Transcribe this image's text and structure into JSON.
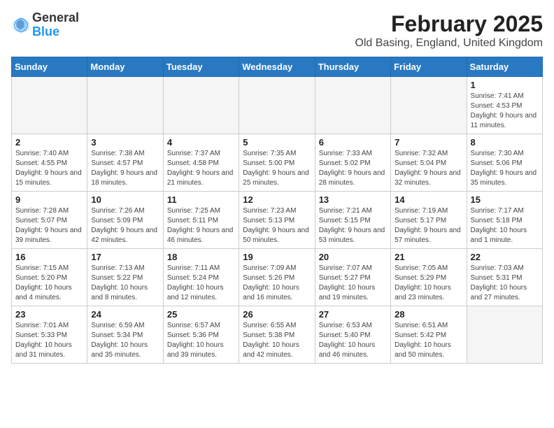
{
  "logo": {
    "general": "General",
    "blue": "Blue"
  },
  "title": "February 2025",
  "subtitle": "Old Basing, England, United Kingdom",
  "headers": [
    "Sunday",
    "Monday",
    "Tuesday",
    "Wednesday",
    "Thursday",
    "Friday",
    "Saturday"
  ],
  "weeks": [
    [
      {
        "day": "",
        "info": ""
      },
      {
        "day": "",
        "info": ""
      },
      {
        "day": "",
        "info": ""
      },
      {
        "day": "",
        "info": ""
      },
      {
        "day": "",
        "info": ""
      },
      {
        "day": "",
        "info": ""
      },
      {
        "day": "1",
        "info": "Sunrise: 7:41 AM\nSunset: 4:53 PM\nDaylight: 9 hours and 11 minutes."
      }
    ],
    [
      {
        "day": "2",
        "info": "Sunrise: 7:40 AM\nSunset: 4:55 PM\nDaylight: 9 hours and 15 minutes."
      },
      {
        "day": "3",
        "info": "Sunrise: 7:38 AM\nSunset: 4:57 PM\nDaylight: 9 hours and 18 minutes."
      },
      {
        "day": "4",
        "info": "Sunrise: 7:37 AM\nSunset: 4:58 PM\nDaylight: 9 hours and 21 minutes."
      },
      {
        "day": "5",
        "info": "Sunrise: 7:35 AM\nSunset: 5:00 PM\nDaylight: 9 hours and 25 minutes."
      },
      {
        "day": "6",
        "info": "Sunrise: 7:33 AM\nSunset: 5:02 PM\nDaylight: 9 hours and 28 minutes."
      },
      {
        "day": "7",
        "info": "Sunrise: 7:32 AM\nSunset: 5:04 PM\nDaylight: 9 hours and 32 minutes."
      },
      {
        "day": "8",
        "info": "Sunrise: 7:30 AM\nSunset: 5:06 PM\nDaylight: 9 hours and 35 minutes."
      }
    ],
    [
      {
        "day": "9",
        "info": "Sunrise: 7:28 AM\nSunset: 5:07 PM\nDaylight: 9 hours and 39 minutes."
      },
      {
        "day": "10",
        "info": "Sunrise: 7:26 AM\nSunset: 5:09 PM\nDaylight: 9 hours and 42 minutes."
      },
      {
        "day": "11",
        "info": "Sunrise: 7:25 AM\nSunset: 5:11 PM\nDaylight: 9 hours and 46 minutes."
      },
      {
        "day": "12",
        "info": "Sunrise: 7:23 AM\nSunset: 5:13 PM\nDaylight: 9 hours and 50 minutes."
      },
      {
        "day": "13",
        "info": "Sunrise: 7:21 AM\nSunset: 5:15 PM\nDaylight: 9 hours and 53 minutes."
      },
      {
        "day": "14",
        "info": "Sunrise: 7:19 AM\nSunset: 5:17 PM\nDaylight: 9 hours and 57 minutes."
      },
      {
        "day": "15",
        "info": "Sunrise: 7:17 AM\nSunset: 5:18 PM\nDaylight: 10 hours and 1 minute."
      }
    ],
    [
      {
        "day": "16",
        "info": "Sunrise: 7:15 AM\nSunset: 5:20 PM\nDaylight: 10 hours and 4 minutes."
      },
      {
        "day": "17",
        "info": "Sunrise: 7:13 AM\nSunset: 5:22 PM\nDaylight: 10 hours and 8 minutes."
      },
      {
        "day": "18",
        "info": "Sunrise: 7:11 AM\nSunset: 5:24 PM\nDaylight: 10 hours and 12 minutes."
      },
      {
        "day": "19",
        "info": "Sunrise: 7:09 AM\nSunset: 5:26 PM\nDaylight: 10 hours and 16 minutes."
      },
      {
        "day": "20",
        "info": "Sunrise: 7:07 AM\nSunset: 5:27 PM\nDaylight: 10 hours and 19 minutes."
      },
      {
        "day": "21",
        "info": "Sunrise: 7:05 AM\nSunset: 5:29 PM\nDaylight: 10 hours and 23 minutes."
      },
      {
        "day": "22",
        "info": "Sunrise: 7:03 AM\nSunset: 5:31 PM\nDaylight: 10 hours and 27 minutes."
      }
    ],
    [
      {
        "day": "23",
        "info": "Sunrise: 7:01 AM\nSunset: 5:33 PM\nDaylight: 10 hours and 31 minutes."
      },
      {
        "day": "24",
        "info": "Sunrise: 6:59 AM\nSunset: 5:34 PM\nDaylight: 10 hours and 35 minutes."
      },
      {
        "day": "25",
        "info": "Sunrise: 6:57 AM\nSunset: 5:36 PM\nDaylight: 10 hours and 39 minutes."
      },
      {
        "day": "26",
        "info": "Sunrise: 6:55 AM\nSunset: 5:38 PM\nDaylight: 10 hours and 42 minutes."
      },
      {
        "day": "27",
        "info": "Sunrise: 6:53 AM\nSunset: 5:40 PM\nDaylight: 10 hours and 46 minutes."
      },
      {
        "day": "28",
        "info": "Sunrise: 6:51 AM\nSunset: 5:42 PM\nDaylight: 10 hours and 50 minutes."
      },
      {
        "day": "",
        "info": ""
      }
    ]
  ]
}
